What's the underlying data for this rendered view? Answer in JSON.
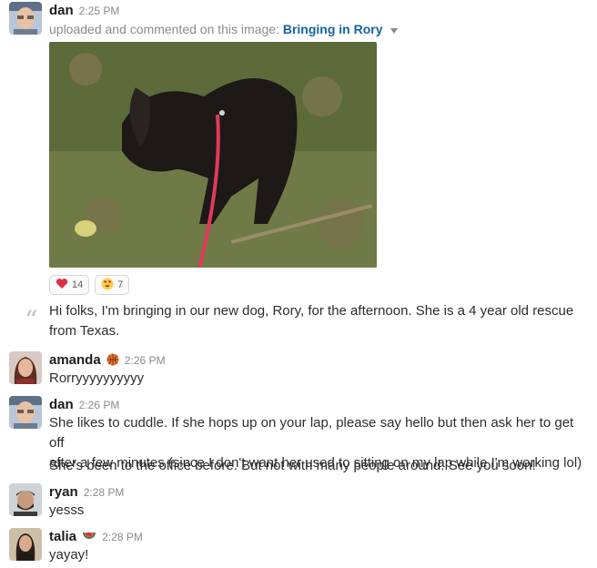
{
  "messages": [
    {
      "user": "dan",
      "time": "2:25 PM",
      "upload_prefix": "uploaded and commented on this image: ",
      "file_title": "Bringing in Rory",
      "reactions": [
        {
          "icon": "heart-emoji",
          "count": "14"
        },
        {
          "icon": "heart-eyes-emoji",
          "count": "7"
        }
      ],
      "comment_line1": "Hi folks, I'm bringing in our new dog, Rory, for the afternoon. She is a 4 year old rescue",
      "comment_line2": "from Texas."
    },
    {
      "user": "amanda",
      "status_icon": "basketball-emoji",
      "time": "2:26 PM",
      "text": "Rorryyyyyyyyyy"
    },
    {
      "user": "dan",
      "time": "2:26 PM",
      "line1": "She likes to cuddle. If she hops up on your lap, please say hello but then ask her to get off",
      "line2": "after a few minutes (since I don't want her used to sitting on my lap while I'm working lol)",
      "line3": "She's been to the office before. But not with many people around. See you soon!"
    },
    {
      "user": "ryan",
      "time": "2:28 PM",
      "text": "yesss"
    },
    {
      "user": "talia",
      "status_icon": "watermelon-emoji",
      "time": "2:28 PM",
      "text": "yayay!"
    }
  ]
}
